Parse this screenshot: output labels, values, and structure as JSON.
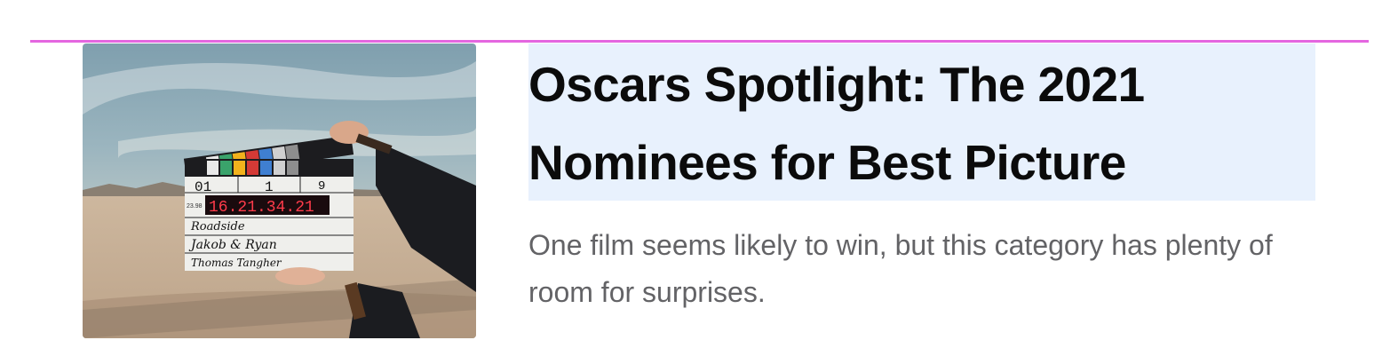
{
  "article": {
    "headline_lines": [
      "Oscars Spotlight: The 2021",
      "Nominees for Best Picture"
    ],
    "dek_lines": [
      "One film seems likely to win, but this category has plenty of",
      "room for surprises."
    ],
    "image": {
      "clapper": {
        "scene": "01",
        "take": "1",
        "roll": "9",
        "timecode": "16.21.34.21",
        "fps": "23.98",
        "production": "Roadside",
        "director": "Jakob & Ryan",
        "camera": "Thomas Tangher"
      }
    }
  },
  "colors": {
    "accent_rule": "#e466e0",
    "headline_bg": "#e8f1fd",
    "headline_text": "#0b0b0b",
    "dek_text": "#636366",
    "timecode": "#ff3b4a"
  }
}
